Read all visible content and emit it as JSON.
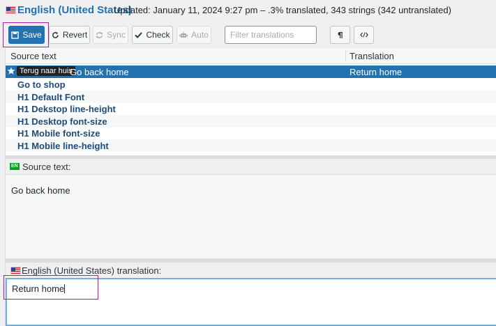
{
  "header": {
    "flag_icon": "us-flag-icon",
    "language_title": "English (United States)",
    "status": "Updated: January 11, 2024 9:27 pm – .3% translated, 343 strings (342 untranslated)"
  },
  "toolbar": {
    "save_label": "Save",
    "revert_label": "Revert",
    "sync_label": "Sync",
    "check_label": "Check",
    "auto_label": "Auto",
    "filter_placeholder": "Filter translations",
    "accent_color": "#2271b1"
  },
  "list": {
    "columns": {
      "source": "Source text",
      "translation": "Translation"
    },
    "selected": {
      "tooltip": "Terug naar huis",
      "source": "Go back home",
      "translation": "Return home"
    },
    "rows": [
      "Go to shop",
      "H1 Default Font",
      "H1 Dekstop line-height",
      "H1 Desktop font-size",
      "H1 Mobile font-size",
      "H1 Mobile line-height"
    ]
  },
  "source_pane": {
    "badge": "EN",
    "label": "Source text:",
    "text": "Go back home"
  },
  "translation_pane": {
    "label": "English (United States) translation:",
    "value": "Return home"
  }
}
